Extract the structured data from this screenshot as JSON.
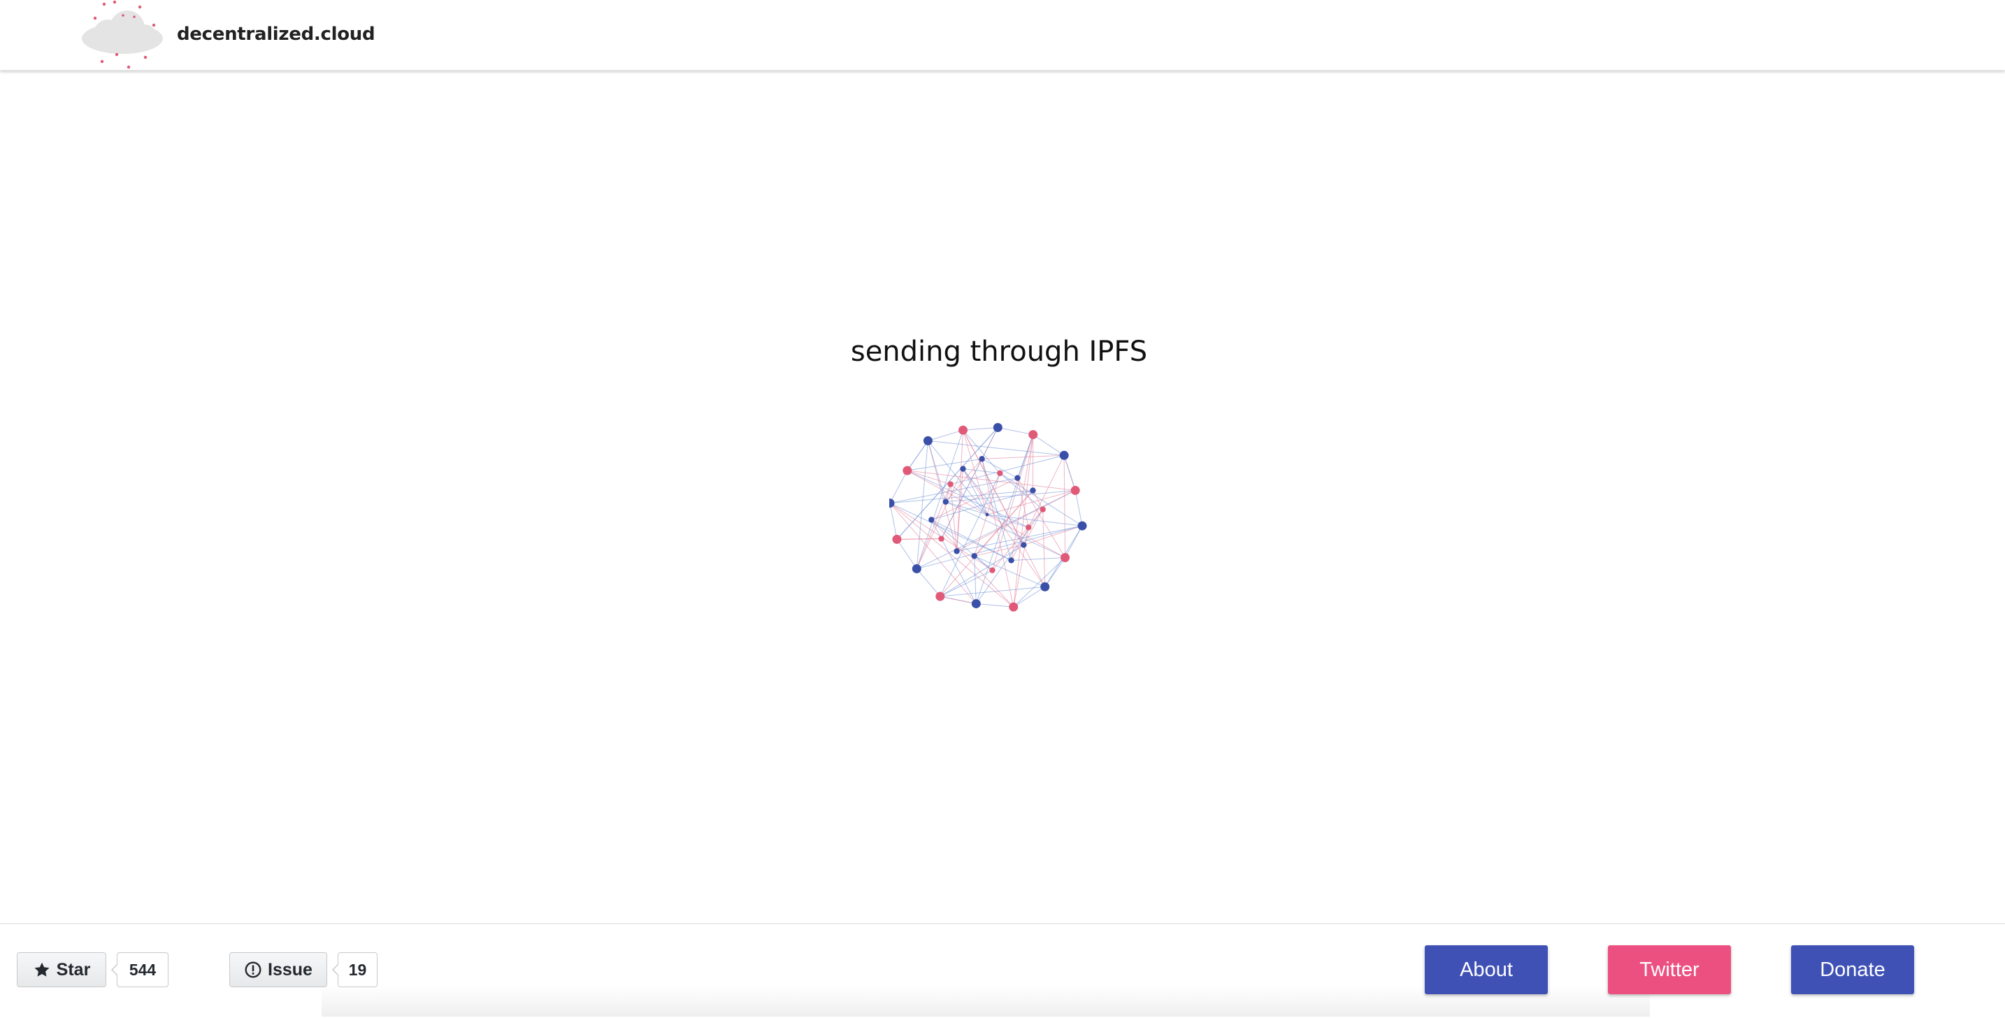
{
  "header": {
    "brand": "decentralized.cloud",
    "logo_icon": "cloud-logo-icon"
  },
  "main": {
    "status_text": "sending through IPFS",
    "graphic_icon": "network-graph-icon"
  },
  "footer": {
    "star": {
      "label": "Star",
      "count": "544",
      "icon": "star-icon"
    },
    "issue": {
      "label": "Issue",
      "count": "19",
      "icon": "issue-opened-icon"
    },
    "about_label": "About",
    "twitter_label": "Twitter",
    "donate_label": "Donate"
  },
  "colors": {
    "primary": "#3f51b5",
    "accent": "#ec5080",
    "node_blue": "#3a4fa8",
    "node_pink": "#e05a78",
    "cloud_gray": "#e6e6e6"
  }
}
